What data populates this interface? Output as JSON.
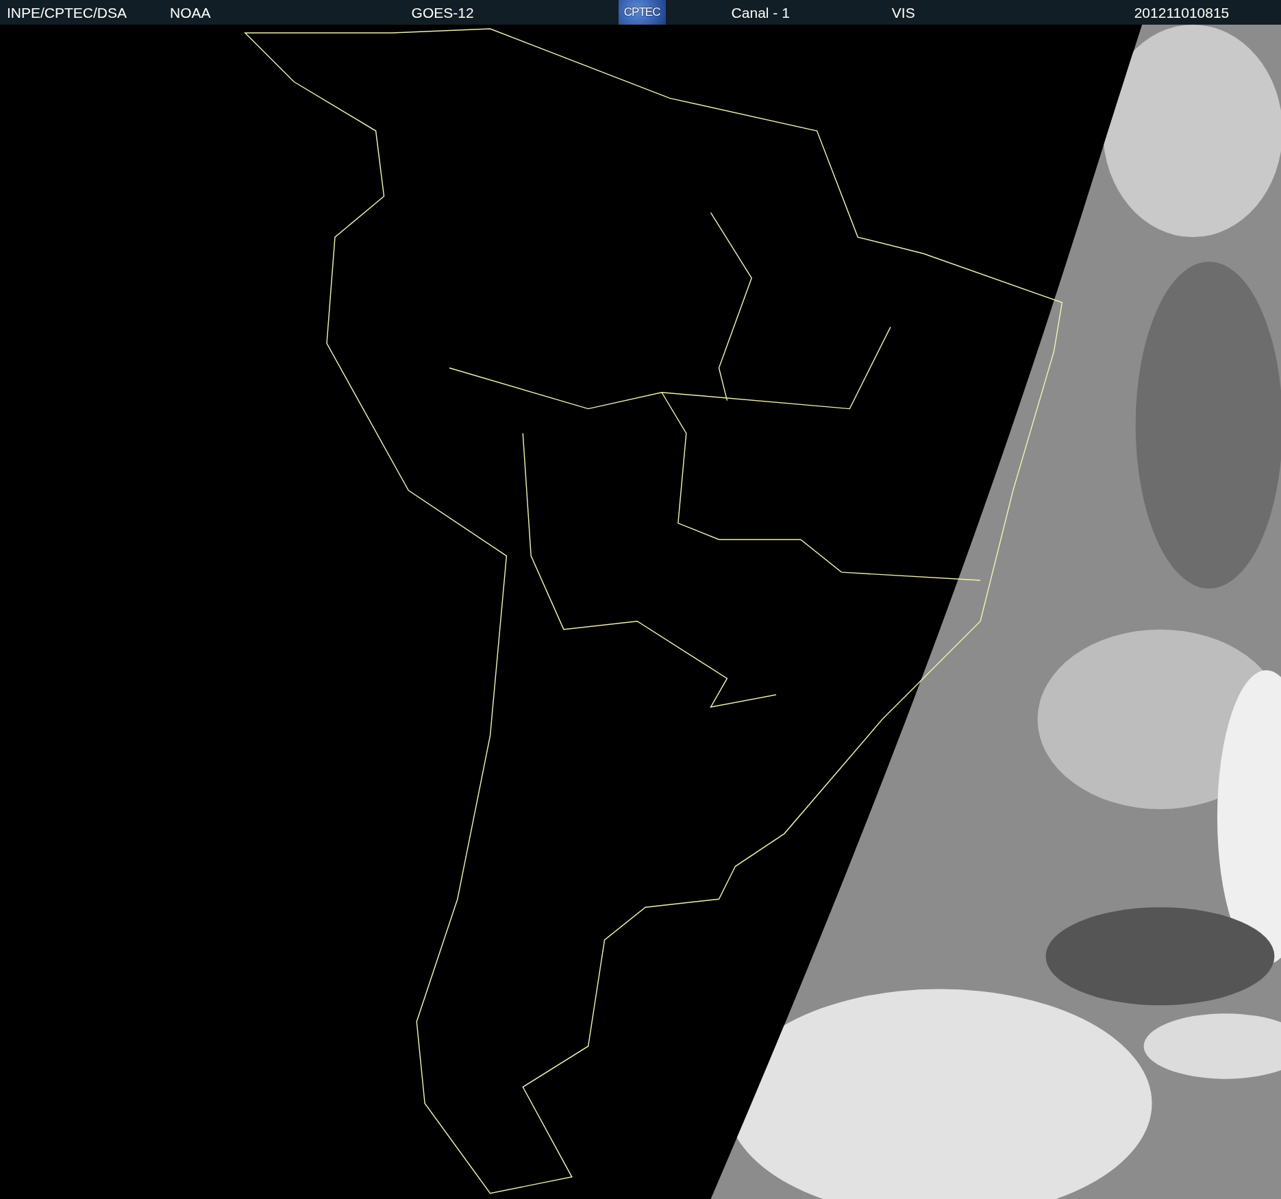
{
  "header": {
    "items": [
      {
        "kind": "text",
        "text": "INPE/CPTEC/DSA"
      },
      {
        "kind": "text",
        "text": "NOAA"
      },
      {
        "kind": "text",
        "text": "GOES-12"
      },
      {
        "kind": "logo",
        "text": "CPTEC"
      },
      {
        "kind": "text",
        "text": "Canal - 1"
      },
      {
        "kind": "text",
        "text": "VIS"
      },
      {
        "kind": "text",
        "text": "201211010815"
      }
    ]
  }
}
